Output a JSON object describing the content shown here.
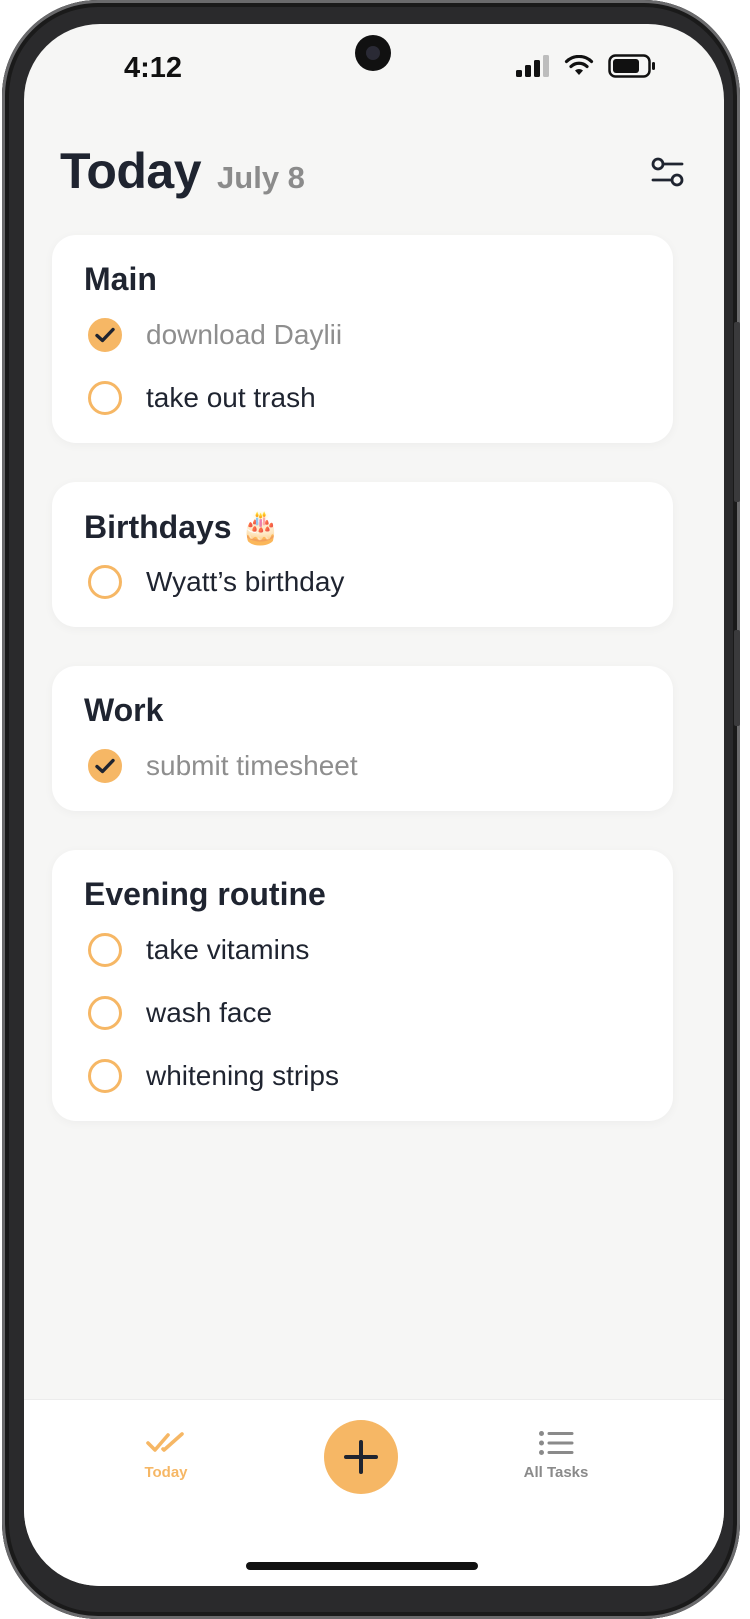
{
  "status_bar": {
    "time": "4:12"
  },
  "header": {
    "title": "Today",
    "date": "July 8"
  },
  "cards": [
    {
      "title": "Main",
      "tasks": [
        {
          "label": "download Daylii",
          "done": true
        },
        {
          "label": "take out trash",
          "done": false
        }
      ]
    },
    {
      "title": "Birthdays 🎂",
      "tasks": [
        {
          "label": "Wyatt’s birthday",
          "done": false
        }
      ]
    },
    {
      "title": "Work",
      "tasks": [
        {
          "label": "submit timesheet",
          "done": true
        }
      ]
    },
    {
      "title": "Evening routine",
      "tasks": [
        {
          "label": "take vitamins",
          "done": false
        },
        {
          "label": "wash face",
          "done": false
        },
        {
          "label": "whitening strips",
          "done": false
        }
      ]
    }
  ],
  "tabbar": {
    "today_label": "Today",
    "all_tasks_label": "All Tasks"
  },
  "colors": {
    "accent": "#f6b765",
    "text_dark": "#1f2430",
    "text_done": "#8e8e8e",
    "tab_inactive": "#8a8a8a"
  },
  "icons": {
    "filter": "sliders-icon",
    "add": "plus-icon",
    "today_tab": "double-check-icon",
    "all_tasks_tab": "list-icon",
    "checked": "checkmark-icon"
  }
}
